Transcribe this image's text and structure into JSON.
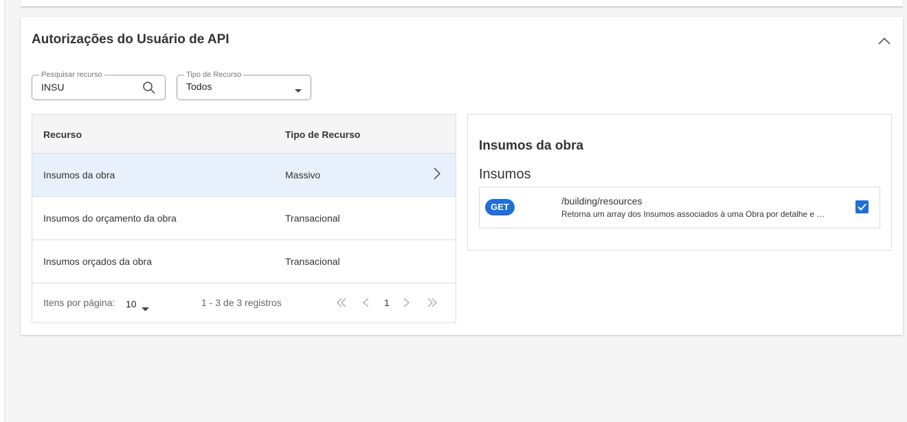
{
  "section": {
    "title": "Autorizações do Usuário de API"
  },
  "filters": {
    "search": {
      "label": "Pesquisar recurso",
      "value": "INSU"
    },
    "type": {
      "label": "Tipo de Recurso",
      "value": "Todos"
    }
  },
  "table": {
    "columns": [
      "Recurso",
      "Tipo de Recurso"
    ],
    "rows": [
      {
        "resource": "Insumos da obra",
        "type": "Massivo",
        "selected": true
      },
      {
        "resource": "Insumos do orçamento da obra",
        "type": "Transacional",
        "selected": false
      },
      {
        "resource": "Insumos orçados da obra",
        "type": "Transacional",
        "selected": false
      }
    ],
    "pagination": {
      "items_label": "Itens por página:",
      "page_size": "10",
      "range_text": "1 - 3 de 3 registros",
      "current_page": "1"
    }
  },
  "detail": {
    "title": "Insumos da obra",
    "group": "Insumos",
    "endpoint": {
      "method": "GET",
      "path": "/building/resources",
      "description": "Retorna um array dos Insumos associados à uma Obra por detalhe e …",
      "checked": true
    }
  },
  "colors": {
    "accent": "#1e6fd9",
    "selected_row": "#e8f1fb"
  }
}
